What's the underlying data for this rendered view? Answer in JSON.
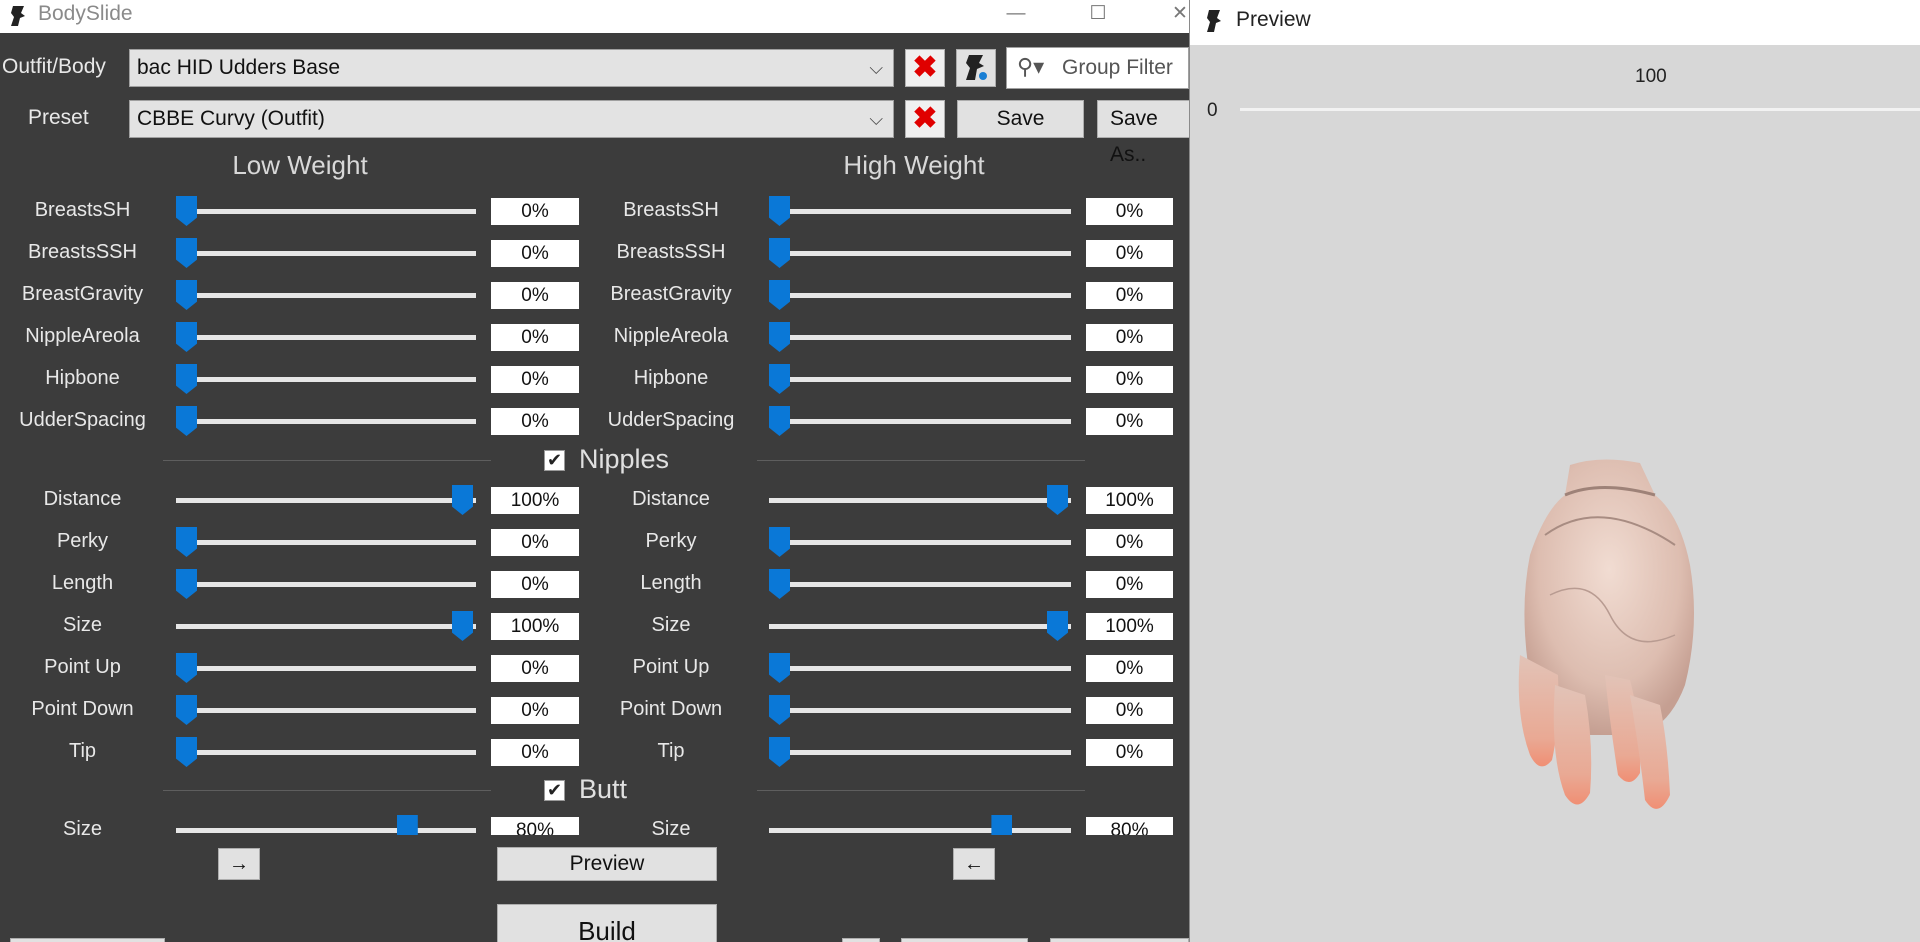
{
  "bodyslide": {
    "title": "BodySlide",
    "win_controls": {
      "minimize": "—",
      "maximize": "☐",
      "close": "✕"
    },
    "outfit_label": "Outfit/Body",
    "outfit_value": "bac HID Udders Base",
    "group_filter_placeholder": "Group Filter",
    "preset_label": "Preset",
    "preset_value": "CBBE Curvy (Outfit)",
    "save_label": "Save",
    "save_as_label": "Save As..",
    "low_heading": "Low Weight",
    "high_heading": "High Weight",
    "sliders_top": [
      {
        "name": "BreastsSH",
        "low": "0%",
        "high": "0%",
        "low_pct": 0,
        "high_pct": 0
      },
      {
        "name": "BreastsSSH",
        "low": "0%",
        "high": "0%",
        "low_pct": 0,
        "high_pct": 0
      },
      {
        "name": "BreastGravity",
        "low": "0%",
        "high": "0%",
        "low_pct": 0,
        "high_pct": 0
      },
      {
        "name": "NippleAreola",
        "low": "0%",
        "high": "0%",
        "low_pct": 0,
        "high_pct": 0
      },
      {
        "name": "Hipbone",
        "low": "0%",
        "high": "0%",
        "low_pct": 0,
        "high_pct": 0
      },
      {
        "name": "UdderSpacing",
        "low": "0%",
        "high": "0%",
        "low_pct": 0,
        "high_pct": 0
      }
    ],
    "nipples_group": "Nipples",
    "sliders_nipples": [
      {
        "name": "Distance",
        "low": "100%",
        "high": "100%",
        "low_pct": 100,
        "high_pct": 100
      },
      {
        "name": "Perky",
        "low": "0%",
        "high": "0%",
        "low_pct": 0,
        "high_pct": 0
      },
      {
        "name": "Length",
        "low": "0%",
        "high": "0%",
        "low_pct": 0,
        "high_pct": 0
      },
      {
        "name": "Size",
        "low": "100%",
        "high": "100%",
        "low_pct": 100,
        "high_pct": 100
      },
      {
        "name": "Point Up",
        "low": "0%",
        "high": "0%",
        "low_pct": 0,
        "high_pct": 0
      },
      {
        "name": "Point Down",
        "low": "0%",
        "high": "0%",
        "low_pct": 0,
        "high_pct": 0
      },
      {
        "name": "Tip",
        "low": "0%",
        "high": "0%",
        "low_pct": 0,
        "high_pct": 0
      }
    ],
    "butt_group": "Butt",
    "sliders_butt": [
      {
        "name": "Size",
        "low": "80%",
        "high": "80%",
        "low_pct": 80,
        "high_pct": 80
      }
    ],
    "arrow_right": "→",
    "arrow_left": "←",
    "preview_label": "Preview",
    "build_label": "Build",
    "colors": {
      "accent": "#0a78d7",
      "panel": "#3c3c3c",
      "delete": "#e00000"
    }
  },
  "preview": {
    "title": "Preview",
    "slider_max": "100",
    "slider_min": "0",
    "slider_value_pct": 0
  }
}
